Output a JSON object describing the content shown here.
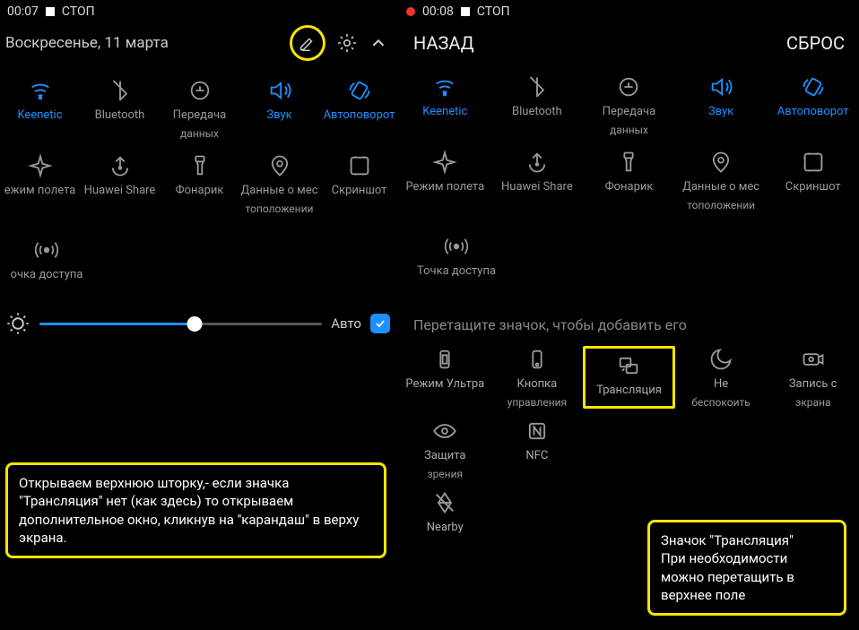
{
  "left": {
    "status_time": "00:07",
    "status_label": "СТОП",
    "date": "Воскресенье, 11 марта",
    "toggles_row1": [
      {
        "name": "wifi",
        "label": "Keenetic",
        "active": true
      },
      {
        "name": "bluetooth",
        "label": "Bluetooth",
        "active": false
      },
      {
        "name": "data",
        "label": "Передача",
        "label2": "данных",
        "active": false
      },
      {
        "name": "sound",
        "label": "Звук",
        "active": true
      },
      {
        "name": "rotate",
        "label": "Автоповорот",
        "active": true
      }
    ],
    "toggles_row2": [
      {
        "name": "airplane",
        "label": "ежим полета",
        "active": false
      },
      {
        "name": "share",
        "label": "Huawei Share",
        "active": false
      },
      {
        "name": "flashlight",
        "label": "Фонарик",
        "active": false
      },
      {
        "name": "location",
        "label": "Данные о мес",
        "label2": "тоположении",
        "active": false
      },
      {
        "name": "screenshot",
        "label": "Скриншот",
        "active": false
      }
    ],
    "hotspot": {
      "label": "очка доступа"
    },
    "auto_label": "Авто",
    "brightness_pct": 55,
    "annotation": "Открываем верхнюю шторку,- если значка \"Трансляция\" нет (как здесь) то открываем дополнительное окно, кликнув на \"карандаш\" в верху экрана."
  },
  "right": {
    "status_time": "00:08",
    "status_label": "СТОП",
    "nav_back": "НАЗАД",
    "nav_reset": "СБРОС",
    "toggles_row1": [
      {
        "name": "wifi",
        "label": "Keenetic",
        "active": true
      },
      {
        "name": "bluetooth",
        "label": "Bluetooth",
        "active": false
      },
      {
        "name": "data",
        "label": "Передача",
        "label2": "данных",
        "active": false
      },
      {
        "name": "sound",
        "label": "Звук",
        "active": true
      },
      {
        "name": "rotate",
        "label": "Автоповорот",
        "active": true
      }
    ],
    "toggles_row2": [
      {
        "name": "airplane",
        "label": "Режим полета",
        "active": false
      },
      {
        "name": "share",
        "label": "Huawei Share",
        "active": false
      },
      {
        "name": "flashlight",
        "label": "Фонарик",
        "active": false
      },
      {
        "name": "location",
        "label": "Данные о мес",
        "label2": "тоположении",
        "active": false
      },
      {
        "name": "screenshot",
        "label": "Скриншот",
        "active": false
      }
    ],
    "hotspot": {
      "label": "Точка доступа"
    },
    "hint": "Перетащите значок, чтобы добавить его",
    "drag_row1": [
      {
        "name": "ultra",
        "label": "Режим Ультра"
      },
      {
        "name": "navbtn",
        "label": "Кнопка",
        "label2": "управления"
      },
      {
        "name": "cast",
        "label": "Трансляция",
        "highlight": true
      },
      {
        "name": "dnd",
        "label": "Не",
        "label2": "беспокоить"
      },
      {
        "name": "record",
        "label": "Запись с",
        "label2": "экрана"
      }
    ],
    "drag_row2": [
      {
        "name": "eye",
        "label": "Защита",
        "label2": "зрения"
      },
      {
        "name": "nfc",
        "label": "NFC"
      }
    ],
    "drag_row3": [
      {
        "name": "nearby",
        "label": "Nearby"
      }
    ],
    "annotation": "Значок \"Трансляция\"\nПри необходимости можно перетащить в верхнее поле"
  }
}
